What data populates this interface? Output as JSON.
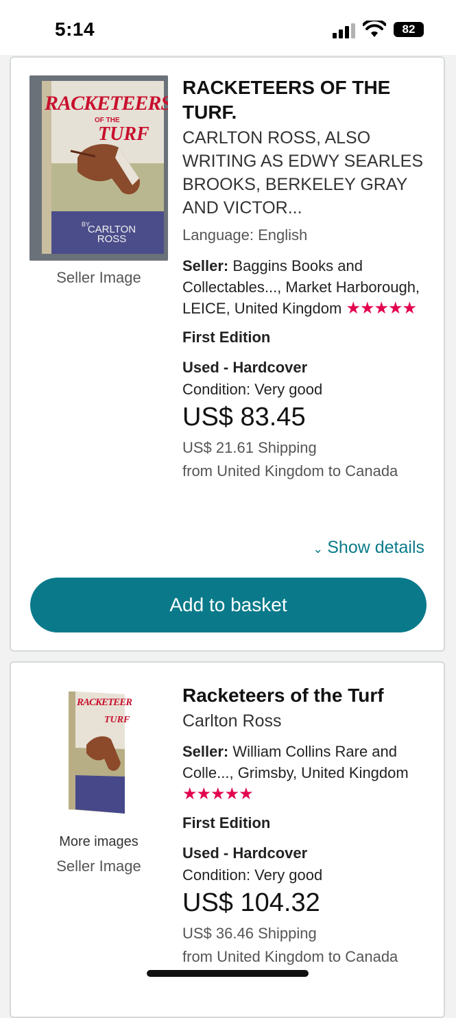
{
  "status_bar": {
    "time": "5:14",
    "battery": "82"
  },
  "listings": [
    {
      "title": "RACKETEERS OF THE TURF.",
      "author": "CARLTON ROSS, ALSO WRITING AS EDWY SEARLES BROOKS, BERKELEY GRAY AND VICTOR...",
      "language": "Language: English",
      "seller_label": "Seller:",
      "seller": "Baggins Books and Collectables..., Market Harborough, LEICE, United Kingdom",
      "stars": "★★★★★",
      "edition": "First Edition",
      "binding": "Used - Hardcover",
      "condition": "Condition: Very good",
      "price": "US$ 83.45",
      "shipping": "US$ 21.61 Shipping",
      "shipping_route": "from United Kingdom to Canada",
      "image_caption": "Seller Image",
      "show_details": "Show details",
      "cta": "Add to basket",
      "cover_title_line1": "RACKETEERS",
      "cover_title_line2": "OF THE",
      "cover_title_line3": "TURF",
      "cover_author_by": "BY",
      "cover_author": "CARLTON ROSS"
    },
    {
      "title": "Racketeers of the Turf",
      "author": "Carlton Ross",
      "seller_label": "Seller:",
      "seller": "William Collins Rare and Colle..., Grimsby, United Kingdom",
      "stars": "★★★★★",
      "edition": "First Edition",
      "binding": "Used - Hardcover",
      "condition": "Condition: Very good",
      "price": "US$ 104.32",
      "shipping": "US$ 36.46 Shipping",
      "shipping_route": "from United Kingdom to Canada",
      "more_images": "More images",
      "image_caption": "Seller Image"
    }
  ],
  "colors": {
    "accent": "#0a7a8a",
    "link": "#0b7b8a",
    "stars": "#e3004f"
  }
}
